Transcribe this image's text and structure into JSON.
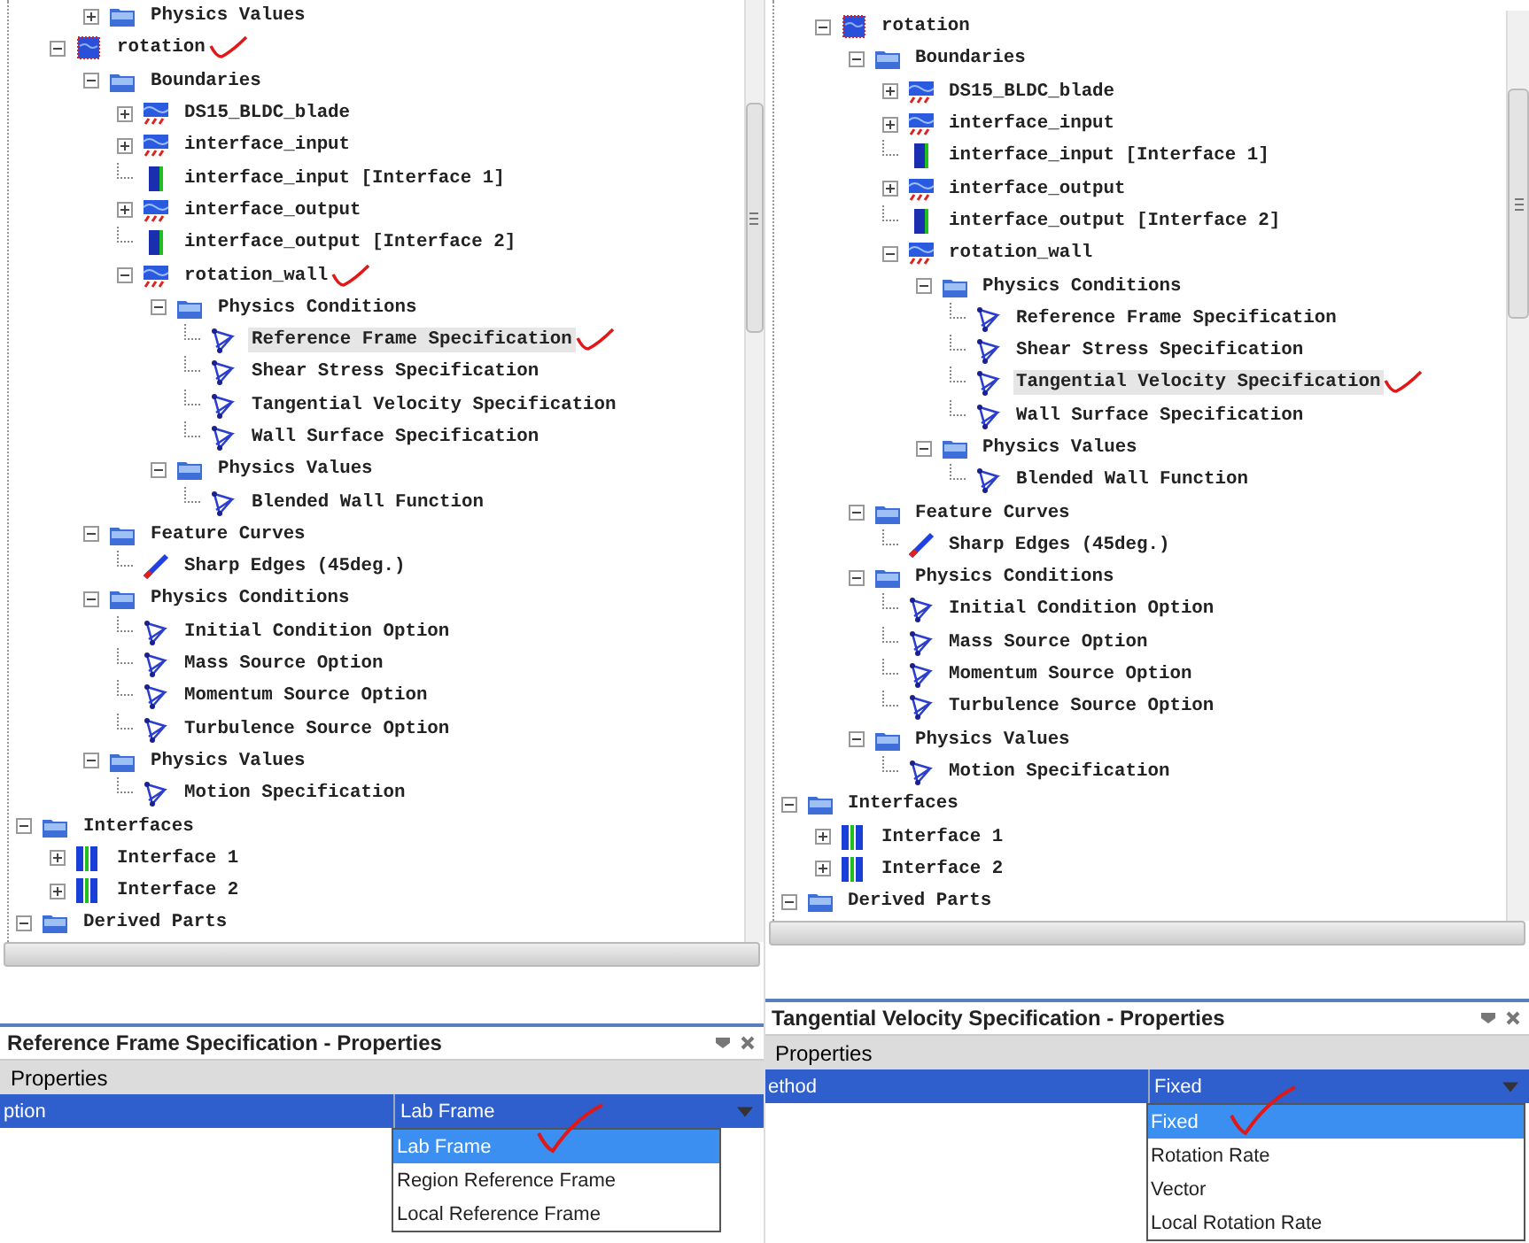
{
  "panels": [
    {
      "tree": {
        "cut_branch_level2": [
          {
            "label": "Physics Values",
            "kind": "folder",
            "expanded": false,
            "selected": false
          }
        ],
        "cut_branch_level1": [
          {
            "label": "rotation",
            "kind": "region",
            "expanded": true,
            "selected": false,
            "annotated": true,
            "children": [
              {
                "label": "Boundaries",
                "kind": "folder",
                "expanded": true,
                "selected": false,
                "children": [
                  {
                    "label": "DS15_BLDC_blade",
                    "kind": "boundary",
                    "expanded": false,
                    "selected": false
                  },
                  {
                    "label": "interface_input",
                    "kind": "boundary",
                    "expanded": false,
                    "selected": false
                  },
                  {
                    "label": "interface_input [Interface 1]",
                    "kind": "interfaceboundary",
                    "selected": false
                  },
                  {
                    "label": "interface_output",
                    "kind": "boundary",
                    "expanded": false,
                    "selected": false
                  },
                  {
                    "label": "interface_output [Interface 2]",
                    "kind": "interfaceboundary",
                    "selected": false
                  },
                  {
                    "label": "rotation_wall",
                    "kind": "boundary",
                    "expanded": true,
                    "selected": false,
                    "annotated": true,
                    "children": [
                      {
                        "label": "Physics Conditions",
                        "kind": "folder",
                        "expanded": true,
                        "selected": false,
                        "children": [
                          {
                            "label": "Reference Frame Specification",
                            "kind": "condition",
                            "selected": true,
                            "annotated": true
                          },
                          {
                            "label": "Shear Stress Specification",
                            "kind": "condition",
                            "selected": false
                          },
                          {
                            "label": "Tangential Velocity Specification",
                            "kind": "condition",
                            "selected": false
                          },
                          {
                            "label": "Wall Surface Specification",
                            "kind": "condition",
                            "selected": false
                          }
                        ]
                      },
                      {
                        "label": "Physics Values",
                        "kind": "folder",
                        "expanded": true,
                        "selected": false,
                        "children": [
                          {
                            "label": "Blended Wall Function",
                            "kind": "condition",
                            "selected": false
                          }
                        ]
                      }
                    ]
                  }
                ]
              },
              {
                "label": "Feature Curves",
                "kind": "folder",
                "expanded": true,
                "selected": false,
                "children": [
                  {
                    "label": "Sharp Edges (45deg.)",
                    "kind": "curve",
                    "selected": false
                  }
                ]
              },
              {
                "label": "Physics Conditions",
                "kind": "folder",
                "expanded": true,
                "selected": false,
                "children": [
                  {
                    "label": "Initial Condition Option",
                    "kind": "condition",
                    "selected": false
                  },
                  {
                    "label": "Mass Source Option",
                    "kind": "condition",
                    "selected": false
                  },
                  {
                    "label": "Momentum Source Option",
                    "kind": "condition",
                    "selected": false
                  },
                  {
                    "label": "Turbulence Source Option",
                    "kind": "condition",
                    "selected": false
                  }
                ]
              },
              {
                "label": "Physics Values",
                "kind": "folder",
                "expanded": true,
                "selected": false,
                "children": [
                  {
                    "label": "Motion Specification",
                    "kind": "condition",
                    "selected": false
                  }
                ]
              }
            ]
          }
        ],
        "items": [
          {
            "label": "Interfaces",
            "kind": "folder",
            "expanded": true,
            "selected": false,
            "children": [
              {
                "label": "Interface 1",
                "kind": "interface",
                "expanded": false,
                "selected": false
              },
              {
                "label": "Interface 2",
                "kind": "interface",
                "expanded": false,
                "selected": false
              }
            ]
          },
          {
            "label": "Derived Parts",
            "kind": "folder",
            "expanded": true,
            "selected": false
          }
        ]
      },
      "properties": {
        "title": "Reference Frame Specification - Properties",
        "section": "Properties",
        "property": {
          "label": "ption",
          "value": "Lab Frame",
          "selected": true,
          "options": [
            {
              "label": "Lab Frame",
              "selected": true,
              "annotated": true
            },
            {
              "label": "Region Reference Frame",
              "selected": false
            },
            {
              "label": "Local Reference Frame",
              "selected": false
            }
          ]
        }
      }
    },
    {
      "tree": {
        "cut_branch_level1": [
          {
            "label": "rotation",
            "kind": "region",
            "expanded": true,
            "selected": false,
            "children": [
              {
                "label": "Boundaries",
                "kind": "folder",
                "expanded": true,
                "selected": false,
                "children": [
                  {
                    "label": "DS15_BLDC_blade",
                    "kind": "boundary",
                    "expanded": false,
                    "selected": false
                  },
                  {
                    "label": "interface_input",
                    "kind": "boundary",
                    "expanded": false,
                    "selected": false
                  },
                  {
                    "label": "interface_input [Interface 1]",
                    "kind": "interfaceboundary",
                    "selected": false
                  },
                  {
                    "label": "interface_output",
                    "kind": "boundary",
                    "expanded": false,
                    "selected": false
                  },
                  {
                    "label": "interface_output [Interface 2]",
                    "kind": "interfaceboundary",
                    "selected": false
                  },
                  {
                    "label": "rotation_wall",
                    "kind": "boundary",
                    "expanded": true,
                    "selected": false,
                    "children": [
                      {
                        "label": "Physics Conditions",
                        "kind": "folder",
                        "expanded": true,
                        "selected": false,
                        "children": [
                          {
                            "label": "Reference Frame Specification",
                            "kind": "condition",
                            "selected": false
                          },
                          {
                            "label": "Shear Stress Specification",
                            "kind": "condition",
                            "selected": false
                          },
                          {
                            "label": "Tangential Velocity Specification",
                            "kind": "condition",
                            "selected": true,
                            "annotated": true
                          },
                          {
                            "label": "Wall Surface Specification",
                            "kind": "condition",
                            "selected": false
                          }
                        ]
                      },
                      {
                        "label": "Physics Values",
                        "kind": "folder",
                        "expanded": true,
                        "selected": false,
                        "children": [
                          {
                            "label": "Blended Wall Function",
                            "kind": "condition",
                            "selected": false
                          }
                        ]
                      }
                    ]
                  }
                ]
              },
              {
                "label": "Feature Curves",
                "kind": "folder",
                "expanded": true,
                "selected": false,
                "children": [
                  {
                    "label": "Sharp Edges (45deg.)",
                    "kind": "curve",
                    "selected": false
                  }
                ]
              },
              {
                "label": "Physics Conditions",
                "kind": "folder",
                "expanded": true,
                "selected": false,
                "children": [
                  {
                    "label": "Initial Condition Option",
                    "kind": "condition",
                    "selected": false
                  },
                  {
                    "label": "Mass Source Option",
                    "kind": "condition",
                    "selected": false
                  },
                  {
                    "label": "Momentum Source Option",
                    "kind": "condition",
                    "selected": false
                  },
                  {
                    "label": "Turbulence Source Option",
                    "kind": "condition",
                    "selected": false
                  }
                ]
              },
              {
                "label": "Physics Values",
                "kind": "folder",
                "expanded": true,
                "selected": false,
                "children": [
                  {
                    "label": "Motion Specification",
                    "kind": "condition",
                    "selected": false
                  }
                ]
              }
            ]
          }
        ],
        "items": [
          {
            "label": "Interfaces",
            "kind": "folder",
            "expanded": true,
            "selected": false,
            "children": [
              {
                "label": "Interface 1",
                "kind": "interface",
                "expanded": false,
                "selected": false
              },
              {
                "label": "Interface 2",
                "kind": "interface",
                "expanded": false,
                "selected": false
              }
            ]
          },
          {
            "label": "Derived Parts",
            "kind": "folder",
            "expanded": true,
            "selected": false
          }
        ]
      },
      "properties": {
        "title": "Tangential Velocity Specification - Properties",
        "section": "Properties",
        "property": {
          "label": "ethod",
          "value": "Fixed",
          "selected": true,
          "options": [
            {
              "label": "Fixed",
              "selected": true,
              "annotated": true
            },
            {
              "label": "Rotation Rate",
              "selected": false
            },
            {
              "label": "Vector",
              "selected": false
            },
            {
              "label": "Local Rotation Rate",
              "selected": false
            }
          ]
        }
      }
    }
  ]
}
